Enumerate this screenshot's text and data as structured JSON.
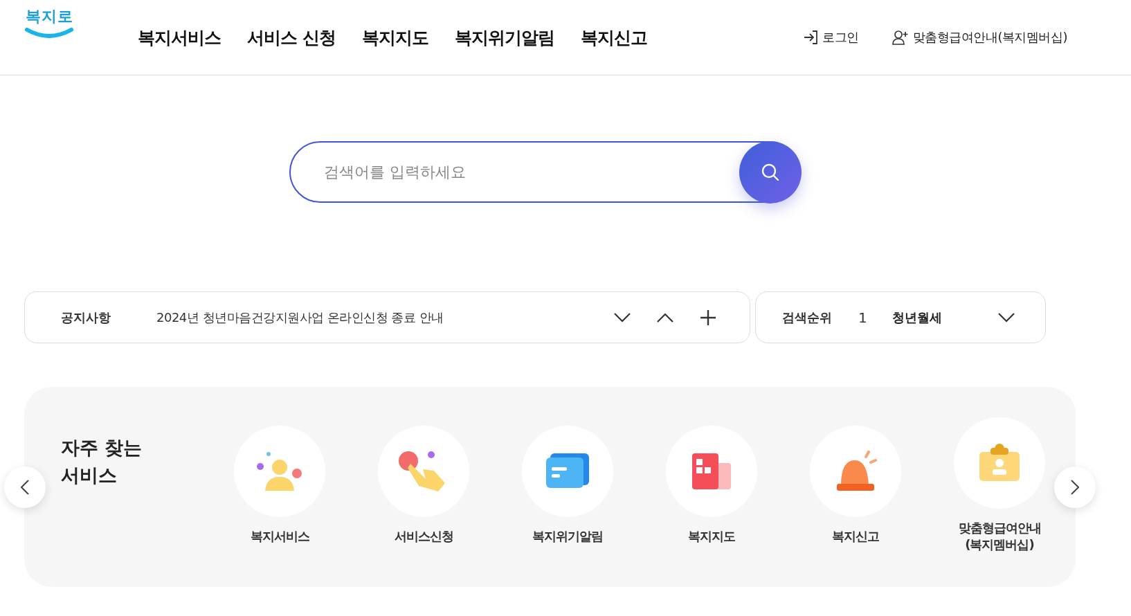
{
  "logo": {
    "text": "복지로"
  },
  "nav": [
    {
      "label": "복지서비스"
    },
    {
      "label": "서비스 신청"
    },
    {
      "label": "복지지도"
    },
    {
      "label": "복지위기알림"
    },
    {
      "label": "복지신고"
    }
  ],
  "user_links": [
    {
      "kind": "login",
      "label": "로그인"
    },
    {
      "kind": "member",
      "label": "맞춤형급여안내(복지멤버십)"
    }
  ],
  "search": {
    "placeholder": "검색어를 입력하세요"
  },
  "notice": {
    "label": "공지사항",
    "text": "2024년 청년마음건강지원사업 온라인신청 종료 안내"
  },
  "ranking": {
    "label": "검색순위",
    "rank": "1",
    "keyword": "청년월세"
  },
  "frequent": {
    "title_lines": [
      "자주 찾는",
      "서비스"
    ],
    "items": [
      {
        "kind": "person",
        "lines": [
          "복지서비스"
        ]
      },
      {
        "kind": "hand",
        "lines": [
          "서비스신청"
        ]
      },
      {
        "kind": "message",
        "lines": [
          "복지위기알림"
        ]
      },
      {
        "kind": "map",
        "lines": [
          "복지지도"
        ]
      },
      {
        "kind": "siren",
        "lines": [
          "복지신고"
        ]
      },
      {
        "kind": "badge",
        "lines": [
          "맞춤형급여안내",
          "(복지멤버십)"
        ]
      }
    ]
  }
}
